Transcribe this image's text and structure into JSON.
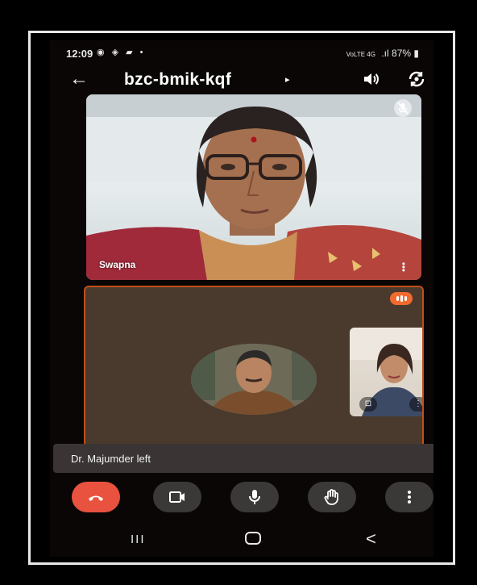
{
  "status_bar": {
    "time": "12:09",
    "left_icons": "◉ ◈ ▰ •",
    "network": "VoLTE 4G",
    "signal": ".ıl",
    "battery": "87%"
  },
  "top_bar": {
    "meeting_code": "bzc-bmik-kqf",
    "code_caret": "▸"
  },
  "tiles": {
    "swapna": {
      "name": "Swapna"
    }
  },
  "toast": {
    "message": "Dr. Majumder left"
  },
  "controls": [
    "end-call",
    "camera",
    "microphone",
    "raise-hand",
    "more-options"
  ],
  "nav": {
    "recents": "III",
    "back": "<"
  },
  "colors": {
    "end_call": "#e8523f",
    "speaking_accent": "#f26a2e",
    "control_bg": "#3b3838",
    "tile_bg": "#4a3a2e"
  }
}
